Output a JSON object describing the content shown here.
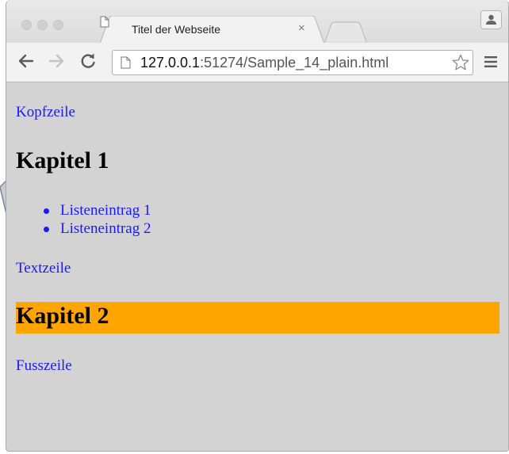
{
  "browser": {
    "tab": {
      "title": "Titel der Webseite",
      "close_glyph": "×"
    },
    "address": {
      "host": "127.0.0.1",
      "rest": ":51274/Sample_14_plain.html"
    },
    "icons": {
      "back": "back-arrow-icon",
      "forward": "forward-arrow-icon",
      "reload": "reload-icon",
      "star": "bookmark-star-icon",
      "menu": "hamburger-menu-icon",
      "profile": "profile-icon"
    }
  },
  "page": {
    "kopfzeile": "Kopfzeile",
    "kapitel1": "Kapitel 1",
    "list_items": [
      "Listeneintrag 1",
      "Listeneintrag 2"
    ],
    "textzeile": "Textzeile",
    "kapitel2": "Kapitel 2",
    "fusszeile": "Fusszeile"
  },
  "colors": {
    "link_blue": "#1a1aff",
    "page_background": "#d3d3d3",
    "heading2_background": "#ffa500",
    "heading_text": "#000000"
  }
}
